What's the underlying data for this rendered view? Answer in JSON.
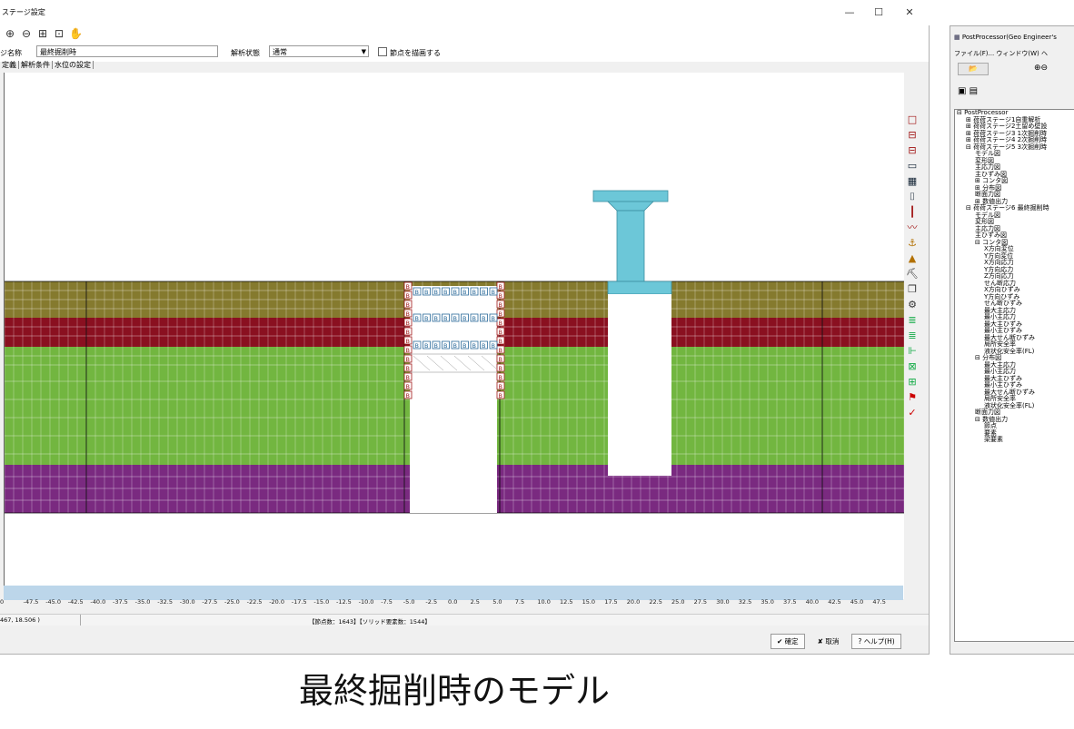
{
  "main": {
    "title": "ステージ設定",
    "window_controls": [
      "—",
      "☐",
      "✕"
    ],
    "stage_label": "ジ名称",
    "stage_name": "最終掘削時",
    "analysis_state_label": "解析状態",
    "analysis_state": "通常",
    "node_draw_label": "節点を描画する",
    "tabs": [
      "定義",
      "解析条件",
      "水位の設定"
    ],
    "status_coords": "467,  18.506 )",
    "status_counts": "【節点数：1643】【ソリッド要素数：1544】",
    "buttons": {
      "ok": "✔ 確定",
      "cancel": "✘ 取消",
      "help": "? ヘルプ(H)"
    },
    "axis_ticks": [
      "0",
      "-47.5",
      "-45.0",
      "-42.5",
      "-40.0",
      "-37.5",
      "-35.0",
      "-32.5",
      "-30.0",
      "-27.5",
      "-25.0",
      "-22.5",
      "-20.0",
      "-17.5",
      "-15.0",
      "-12.5",
      "-10.0",
      "-7.5",
      "-5.0",
      "-2.5",
      "0.0",
      "2.5",
      "5.0",
      "7.5",
      "10.0",
      "12.5",
      "15.0",
      "17.5",
      "20.0",
      "22.5",
      "25.0",
      "27.5",
      "30.0",
      "32.5",
      "35.0",
      "37.5",
      "40.0",
      "42.5",
      "45.0",
      "47.5"
    ],
    "beam_label": "B",
    "colors": {
      "olive": "#857a2e",
      "maroon": "#8a1020",
      "green": "#72b640",
      "purple": "#7a2a80",
      "cyan": "#6cc7d8"
    }
  },
  "postprocessor": {
    "title": "PostProcessor(Geo Engineer's",
    "menu": "ファイル(F)...  ウィンドウ(W)  ヘ",
    "tree": [
      {
        "indent": 0,
        "text": "⊟ PostProcessor"
      },
      {
        "indent": 1,
        "text": "⊞ 荷荷ステージ1自重解析"
      },
      {
        "indent": 1,
        "text": "⊞ 荷荷ステージ2土留め壁設"
      },
      {
        "indent": 1,
        "text": "⊞ 荷荷ステージ3 1次掘削時"
      },
      {
        "indent": 1,
        "text": "⊞ 荷荷ステージ4 2次掘削時"
      },
      {
        "indent": 1,
        "text": "⊟ 荷荷ステージ5 3次掘削時"
      },
      {
        "indent": 2,
        "text": "モデル図"
      },
      {
        "indent": 2,
        "text": "変形図"
      },
      {
        "indent": 2,
        "text": "主応力図"
      },
      {
        "indent": 2,
        "text": "主ひずみ図"
      },
      {
        "indent": 2,
        "text": "⊞ コンタ図"
      },
      {
        "indent": 2,
        "text": "⊞ 分布図"
      },
      {
        "indent": 2,
        "text": "断面力図"
      },
      {
        "indent": 2,
        "text": "⊞ 数値出力"
      },
      {
        "indent": 1,
        "text": "⊟ 荷荷ステージ6 最終掘削時"
      },
      {
        "indent": 2,
        "text": "モデル図"
      },
      {
        "indent": 2,
        "text": "変形図"
      },
      {
        "indent": 2,
        "text": "主応力図"
      },
      {
        "indent": 2,
        "text": "主ひずみ図"
      },
      {
        "indent": 2,
        "text": "⊟ コンタ図"
      },
      {
        "indent": 3,
        "text": "X方向変位"
      },
      {
        "indent": 3,
        "text": "Y方向変位"
      },
      {
        "indent": 3,
        "text": "X方向応力"
      },
      {
        "indent": 3,
        "text": "Y方向応力"
      },
      {
        "indent": 3,
        "text": "Z方向応力"
      },
      {
        "indent": 3,
        "text": "せん断応力"
      },
      {
        "indent": 3,
        "text": "X方向ひずみ"
      },
      {
        "indent": 3,
        "text": "Y方向ひずみ"
      },
      {
        "indent": 3,
        "text": "せん断ひずみ"
      },
      {
        "indent": 3,
        "text": "最大主応力"
      },
      {
        "indent": 3,
        "text": "最小主応力"
      },
      {
        "indent": 3,
        "text": "最大主ひずみ"
      },
      {
        "indent": 3,
        "text": "最小主ひずみ"
      },
      {
        "indent": 3,
        "text": "最大せん断ひずみ"
      },
      {
        "indent": 3,
        "text": "局所安全率"
      },
      {
        "indent": 3,
        "text": "液状化安全率(FL)"
      },
      {
        "indent": 2,
        "text": "⊟ 分布図"
      },
      {
        "indent": 3,
        "text": "最大主応力"
      },
      {
        "indent": 3,
        "text": "最小主応力"
      },
      {
        "indent": 3,
        "text": "最大主ひずみ"
      },
      {
        "indent": 3,
        "text": "最小主ひずみ"
      },
      {
        "indent": 3,
        "text": "最大せん断ひずみ"
      },
      {
        "indent": 3,
        "text": "局所安全率"
      },
      {
        "indent": 3,
        "text": "液状化安全率(FL)"
      },
      {
        "indent": 2,
        "text": "断面力図"
      },
      {
        "indent": 2,
        "text": "⊟ 数値出力"
      },
      {
        "indent": 3,
        "text": "節点"
      },
      {
        "indent": 3,
        "text": "要素"
      },
      {
        "indent": 3,
        "text": "梁要素"
      }
    ]
  },
  "caption": "最終掘削時のモデル"
}
